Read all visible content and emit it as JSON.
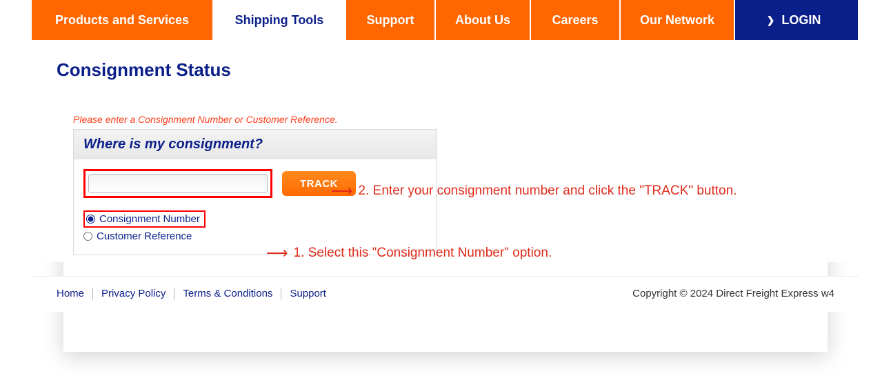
{
  "nav": {
    "products": "Products and Services",
    "shipping": "Shipping Tools",
    "support": "Support",
    "about": "About Us",
    "careers": "Careers",
    "network": "Our Network",
    "login": "LOGIN"
  },
  "page": {
    "title": "Consignment Status",
    "instruction": "Please enter a Consignment Number or Customer Reference."
  },
  "trackbox": {
    "heading": "Where is my consignment?",
    "input_value": "",
    "button_label": "TRACK",
    "radio_consignment": "Consignment Number",
    "radio_reference": "Customer Reference"
  },
  "annotations": {
    "step1": "1. Select this \"Consignment Number\" option.",
    "step2": "2. Enter your consignment number and click the \"TRACK\" button."
  },
  "footer": {
    "home": "Home",
    "privacy": "Privacy Policy",
    "terms": "Terms & Conditions",
    "support": "Support",
    "copyright": "Copyright © 2024 Direct Freight Express w4"
  }
}
